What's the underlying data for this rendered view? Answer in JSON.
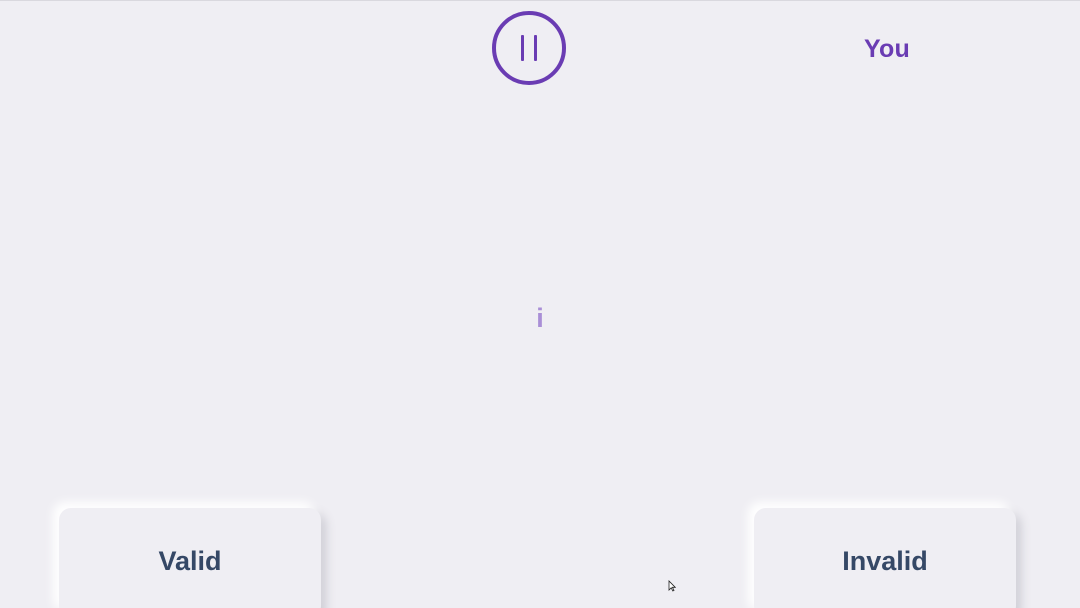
{
  "player": {
    "label": "You"
  },
  "prompt": {
    "character": "i"
  },
  "controls": {
    "pause_icon": "pause-icon"
  },
  "answers": {
    "valid_label": "Valid",
    "invalid_label": "Invalid"
  },
  "colors": {
    "accent": "#6a3cb3",
    "prompt": "#a98fd6",
    "answer_text": "#354866",
    "background": "#efeef3"
  }
}
